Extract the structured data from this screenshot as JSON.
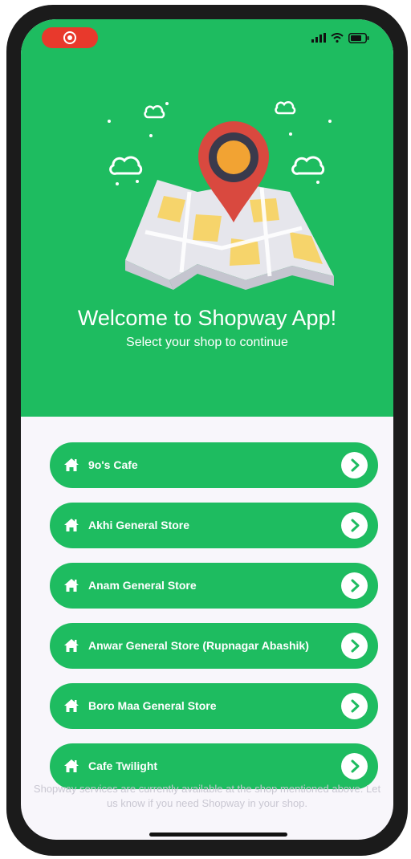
{
  "welcome": {
    "title": "Welcome to Shopway App!",
    "subtitle": "Select your shop to continue"
  },
  "shops": [
    {
      "name": "9o's Cafe"
    },
    {
      "name": "Akhi General Store"
    },
    {
      "name": "Anam General Store"
    },
    {
      "name": "Anwar General Store (Rupnagar Abashik)"
    },
    {
      "name": "Boro Maa General Store"
    },
    {
      "name": "Cafe Twilight"
    }
  ],
  "footer_note": "Shopway services are currently available at the shop mentioned above. Let us know if you need Shopway in your shop.",
  "icons": {
    "record": "screen-record-icon",
    "signal": "cellular-signal-icon",
    "wifi": "wifi-icon",
    "battery": "battery-icon",
    "shop": "home-icon",
    "chevron": "chevron-right-icon"
  },
  "colors": {
    "brand_green": "#1ebc60",
    "list_background": "#f8f6fb",
    "record_red": "#e8392c"
  }
}
